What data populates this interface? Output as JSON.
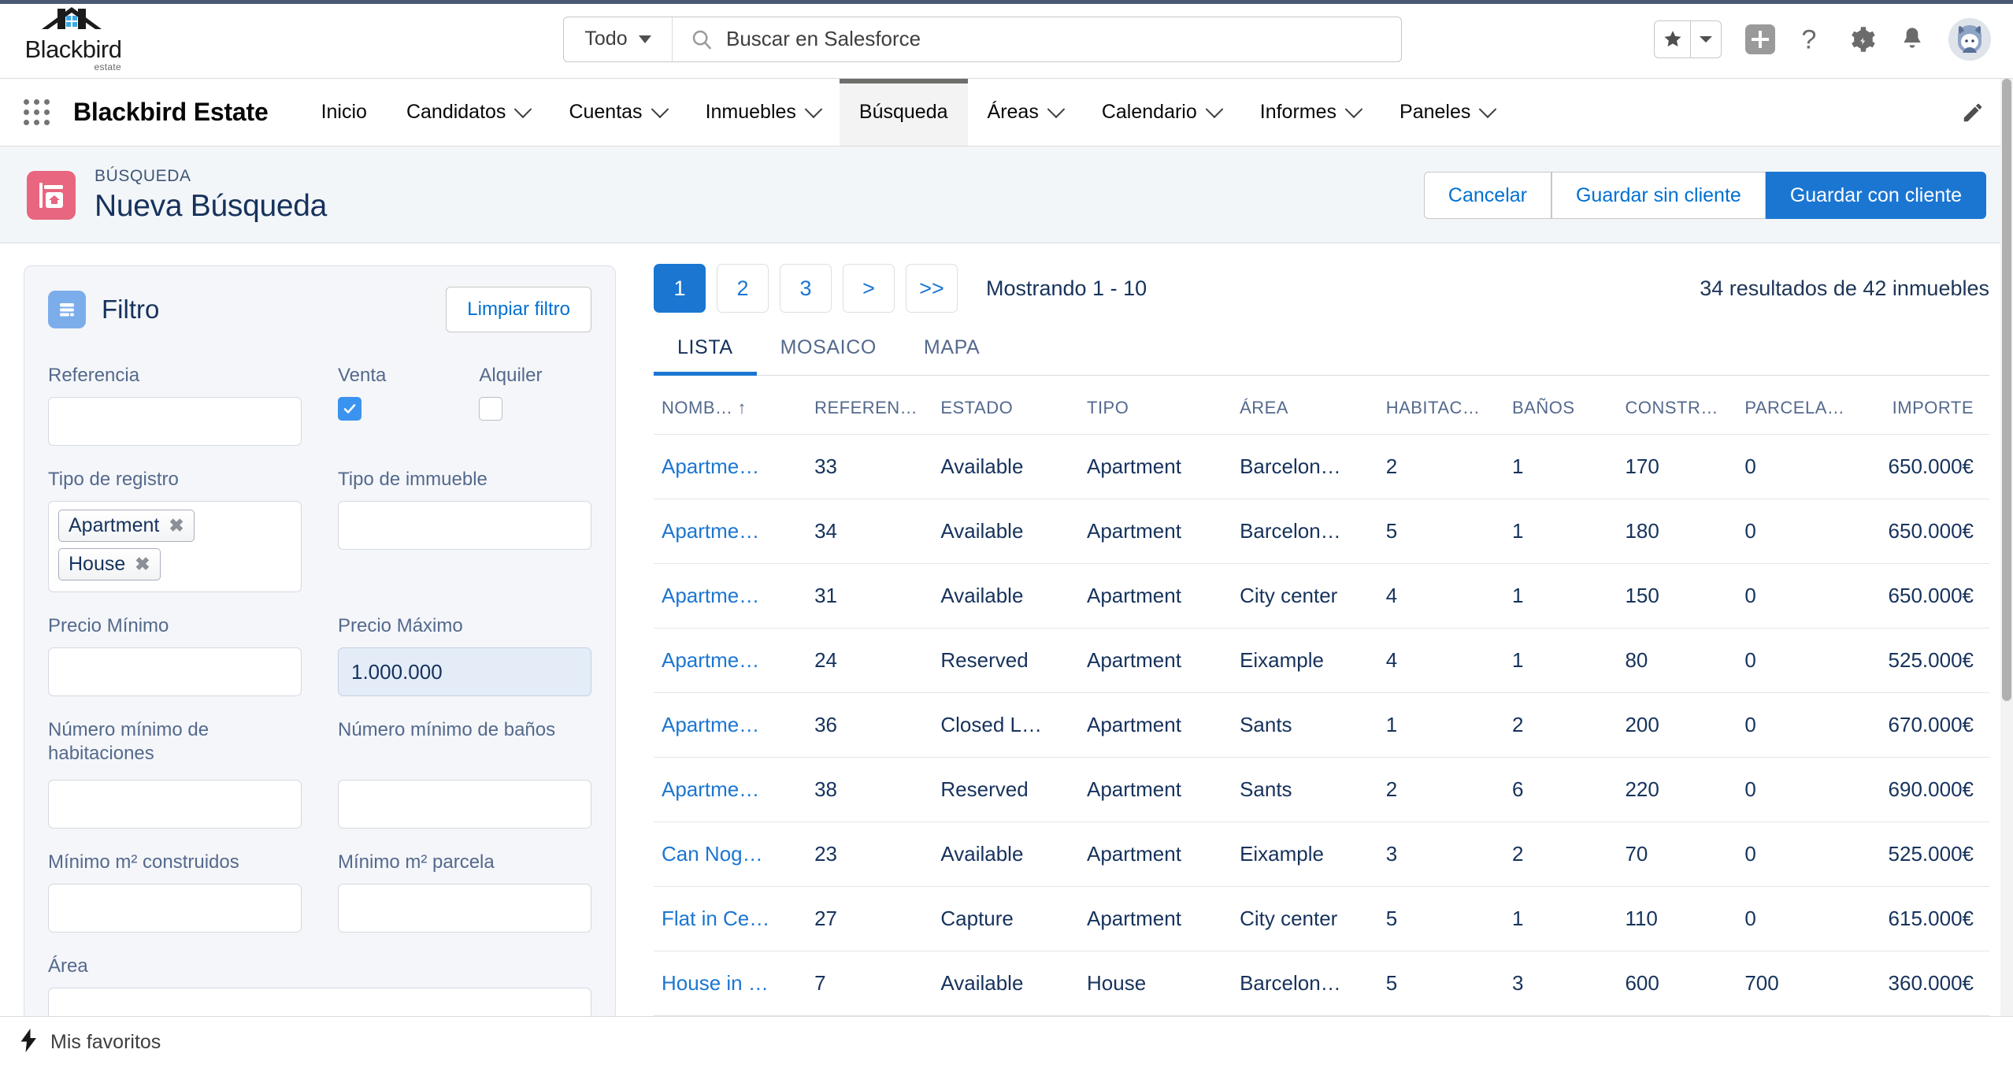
{
  "brand": {
    "logo_word": "Blackbird",
    "logo_sub": "estate"
  },
  "search": {
    "scope_label": "Todo",
    "placeholder": "Buscar en Salesforce",
    "value": ""
  },
  "header_icons": {
    "favorites": "star-icon",
    "favorites_caret": "chevron-down-icon",
    "add": "plus-icon",
    "help": "question-mark-icon",
    "setup": "gear-icon",
    "notifications": "bell-icon",
    "avatar": "user-avatar"
  },
  "appnav": {
    "app_name": "Blackbird Estate",
    "items": [
      {
        "label": "Inicio",
        "has_menu": false,
        "active": false
      },
      {
        "label": "Candidatos",
        "has_menu": true,
        "active": false
      },
      {
        "label": "Cuentas",
        "has_menu": true,
        "active": false
      },
      {
        "label": "Inmuebles",
        "has_menu": true,
        "active": false
      },
      {
        "label": "Búsqueda",
        "has_menu": false,
        "active": true
      },
      {
        "label": "Áreas",
        "has_menu": true,
        "active": false
      },
      {
        "label": "Calendario",
        "has_menu": true,
        "active": false
      },
      {
        "label": "Informes",
        "has_menu": true,
        "active": false
      },
      {
        "label": "Paneles",
        "has_menu": true,
        "active": false
      }
    ],
    "edit_icon": "pencil-icon"
  },
  "page_header": {
    "eyebrow": "BÚSQUEDA",
    "title": "Nueva Búsqueda",
    "icon_color": "#e8667f",
    "buttons": [
      {
        "label": "Cancelar",
        "variant": "neutral"
      },
      {
        "label": "Guardar sin cliente",
        "variant": "neutral"
      },
      {
        "label": "Guardar con cliente",
        "variant": "brand"
      }
    ]
  },
  "filter": {
    "title": "Filtro",
    "clear_label": "Limpiar filtro",
    "fields": {
      "referencia_label": "Referencia",
      "referencia_value": "",
      "venta_label": "Venta",
      "venta_checked": true,
      "alquiler_label": "Alquiler",
      "alquiler_checked": false,
      "tipo_registro_label": "Tipo de registro",
      "tipo_registro_pills": [
        "Apartment",
        "House"
      ],
      "tipo_inmueble_label": "Tipo de immueble",
      "tipo_inmueble_value": "",
      "precio_minimo_label": "Precio Mínimo",
      "precio_minimo_value": "",
      "precio_maximo_label": "Precio Máximo",
      "precio_maximo_value": "1.000.000",
      "num_habitaciones_label": "Número mínimo de habitaciones",
      "num_habitaciones_value": "",
      "num_banos_label": "Número mínimo de baños",
      "num_banos_value": "",
      "min_construidos_label": "Mínimo m² construidos",
      "min_construidos_value": "",
      "min_parcela_label": "Mínimo m² parcela",
      "min_parcela_value": "",
      "area_label": "Área",
      "area_value": ""
    }
  },
  "results": {
    "pages": [
      "1",
      "2",
      "3"
    ],
    "next_label": ">",
    "last_label": ">>",
    "active_page": "1",
    "showing": "Mostrando 1 - 10",
    "count_text": "34 resultados de 42 inmuebles",
    "tabs": [
      {
        "label": "LISTA",
        "active": true
      },
      {
        "label": "MOSAICO",
        "active": false
      },
      {
        "label": "MAPA",
        "active": false
      }
    ],
    "columns": [
      {
        "label": "NOMB…",
        "sorted": true,
        "sort_dir": "↑",
        "align": "left"
      },
      {
        "label": "REFEREN…",
        "align": "left"
      },
      {
        "label": "ESTADO",
        "align": "left"
      },
      {
        "label": "TIPO",
        "align": "left"
      },
      {
        "label": "ÁREA",
        "align": "left"
      },
      {
        "label": "HABITAC…",
        "align": "left"
      },
      {
        "label": "BAÑOS",
        "align": "left"
      },
      {
        "label": "CONSTR…",
        "align": "left"
      },
      {
        "label": "PARCELA…",
        "align": "left"
      },
      {
        "label": "IMPORTE",
        "align": "right"
      }
    ],
    "rows": [
      {
        "nombre": "Apartme…",
        "referencia": "33",
        "estado": "Available",
        "tipo": "Apartment",
        "area": "Barcelon…",
        "habitaciones": "2",
        "banos": "1",
        "construidos": "170",
        "parcela": "0",
        "importe": "650.000€"
      },
      {
        "nombre": "Apartme…",
        "referencia": "34",
        "estado": "Available",
        "tipo": "Apartment",
        "area": "Barcelon…",
        "habitaciones": "5",
        "banos": "1",
        "construidos": "180",
        "parcela": "0",
        "importe": "650.000€"
      },
      {
        "nombre": "Apartme…",
        "referencia": "31",
        "estado": "Available",
        "tipo": "Apartment",
        "area": "City center",
        "habitaciones": "4",
        "banos": "1",
        "construidos": "150",
        "parcela": "0",
        "importe": "650.000€"
      },
      {
        "nombre": "Apartme…",
        "referencia": "24",
        "estado": "Reserved",
        "tipo": "Apartment",
        "area": "Eixample",
        "habitaciones": "4",
        "banos": "1",
        "construidos": "80",
        "parcela": "0",
        "importe": "525.000€"
      },
      {
        "nombre": "Apartme…",
        "referencia": "36",
        "estado": "Closed L…",
        "tipo": "Apartment",
        "area": "Sants",
        "habitaciones": "1",
        "banos": "2",
        "construidos": "200",
        "parcela": "0",
        "importe": "670.000€"
      },
      {
        "nombre": "Apartme…",
        "referencia": "38",
        "estado": "Reserved",
        "tipo": "Apartment",
        "area": "Sants",
        "habitaciones": "2",
        "banos": "6",
        "construidos": "220",
        "parcela": "0",
        "importe": "690.000€"
      },
      {
        "nombre": "Can Nog…",
        "referencia": "23",
        "estado": "Available",
        "tipo": "Apartment",
        "area": "Eixample",
        "habitaciones": "3",
        "banos": "2",
        "construidos": "70",
        "parcela": "0",
        "importe": "525.000€"
      },
      {
        "nombre": "Flat in Ce…",
        "referencia": "27",
        "estado": "Capture",
        "tipo": "Apartment",
        "area": "City center",
        "habitaciones": "5",
        "banos": "1",
        "construidos": "110",
        "parcela": "0",
        "importe": "615.000€"
      },
      {
        "nombre": "House in …",
        "referencia": "7",
        "estado": "Available",
        "tipo": "House",
        "area": "Barcelon…",
        "habitaciones": "5",
        "banos": "3",
        "construidos": "600",
        "parcela": "700",
        "importe": "360.000€"
      }
    ]
  },
  "utility_bar": {
    "favorites_label": "Mis favoritos",
    "favorites_icon": "lightning-icon"
  }
}
